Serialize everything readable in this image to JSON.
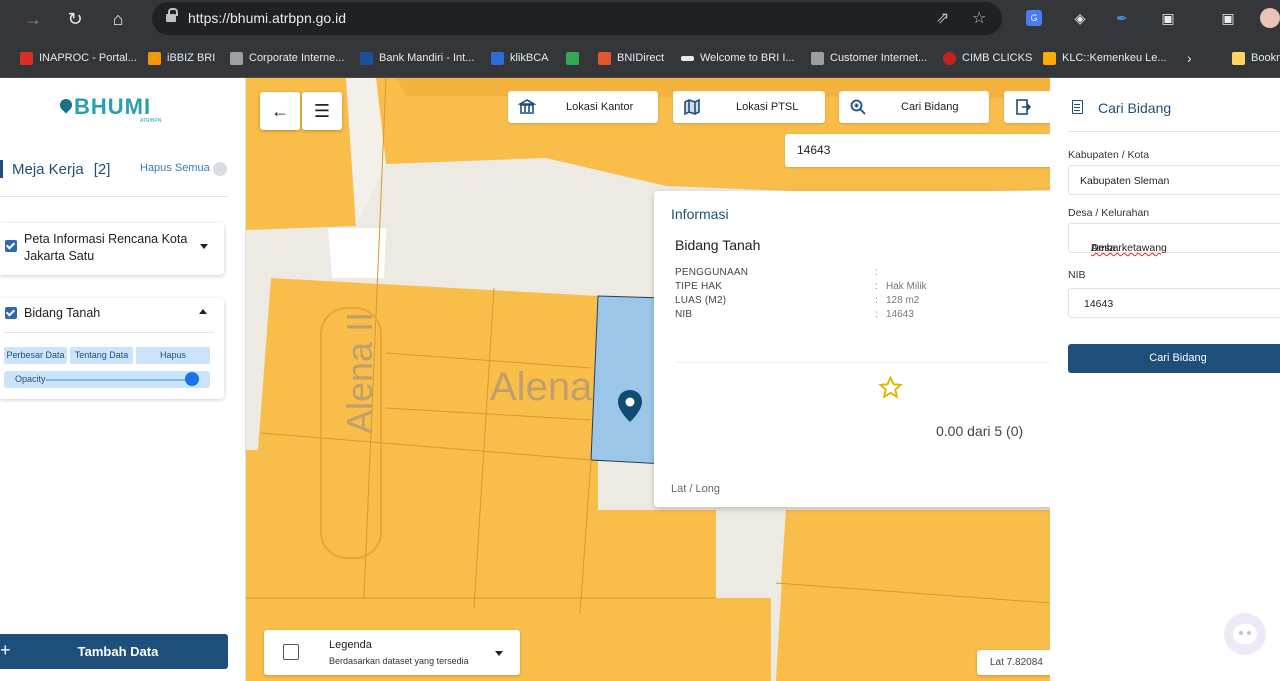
{
  "browser": {
    "url": "https://bhumi.atrbpn.go.id",
    "bookmarks": [
      {
        "label": "INAPROC - Portal...",
        "color": "#d93025"
      },
      {
        "label": "iBBIZ BRI",
        "color": "#f29900"
      },
      {
        "label": "Corporate Interne...",
        "color": "#9aa0a6"
      },
      {
        "label": "Bank Mandiri - Int...",
        "color": "#1a4f9c"
      },
      {
        "label": "klikBCA",
        "color": "#2f6bd8"
      },
      {
        "label": "",
        "color": "#34a853"
      },
      {
        "label": "BNIDirect",
        "color": "#e4572e"
      },
      {
        "label": "Welcome to BRI I...",
        "color": "#e8eaed"
      },
      {
        "label": "Customer Internet...",
        "color": "#9aa0a6"
      },
      {
        "label": "CIMB CLICKS",
        "color": "#c5221f"
      },
      {
        "label": "KLC::Kemenkeu Le...",
        "color": "#f9ab00"
      },
      {
        "label": "Bookm",
        "color": "#fdd663"
      }
    ]
  },
  "sidebar": {
    "logo": "BHUMI",
    "logo_sub": "ATR/BPN",
    "meja_title": "Meja Kerja",
    "meja_count": "[2]",
    "hapus_semua": "Hapus Semua",
    "layers": [
      {
        "label": "Peta Informasi Rencana Kota Jakarta Satu",
        "expanded": false
      },
      {
        "label": "Bidang Tanah",
        "expanded": true
      }
    ],
    "chips": [
      "Perbesar Data",
      "Tentang Data",
      "Hapus"
    ],
    "opacity_label": "Opacity",
    "tambah": "Tambah Data"
  },
  "map": {
    "toolbar": [
      "Lokasi Kantor",
      "Lokasi PTSL",
      "Cari Bidang"
    ],
    "search_value": "14643",
    "street_labels": [
      "Alena II",
      "Alena"
    ],
    "popup": {
      "title": "Informasi",
      "subtitle": "Bidang Tanah",
      "rows": [
        {
          "key": "PENGGUNAAN",
          "value": ""
        },
        {
          "key": "TIPE HAK",
          "value": "Hak Milik"
        },
        {
          "key": "LUAS (M2)",
          "value": "128 m2"
        },
        {
          "key": "NIB",
          "value": "14643"
        }
      ],
      "rating_text": "0.00 dari 5 (0)",
      "stars": 4,
      "latlong": "Lat / Long"
    },
    "legend": {
      "title": "Legenda",
      "subtitle": "Berdasarkan dataset yang tersedia"
    },
    "lat_text": "Lat  7.82084",
    "colors": {
      "parcel": "#f9bd4a",
      "selected": "#9cc6e7",
      "road": "#ede9e3"
    }
  },
  "panel": {
    "title": "Cari Bidang",
    "kab_label": "Kabupaten / Kota",
    "kab_value": "Kabupaten Sleman",
    "desa_label": "Desa / Kelurahan",
    "desa_prefix": "Desa ",
    "desa_value": "Ambarketawang",
    "nib_label": "NIB",
    "nib_value": "14643",
    "button": "Cari Bidang"
  }
}
